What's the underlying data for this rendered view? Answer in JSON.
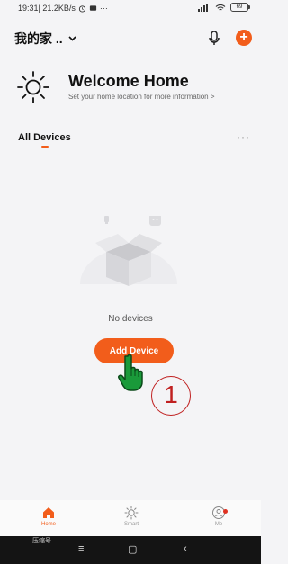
{
  "status_bar": {
    "time_speed": "19:31| 21.2KB/s",
    "more": "···",
    "signal": "░▐",
    "battery": "69"
  },
  "header": {
    "home_name": "我的家 ..",
    "chevron": "⌄"
  },
  "welcome": {
    "title": "Welcome Home",
    "subtitle": "Set your home location for more information >"
  },
  "devices": {
    "tab_label": "All Devices",
    "more": "···",
    "empty_text": "No devices",
    "add_button": "Add Device"
  },
  "annotation": {
    "step_number": "1"
  },
  "bottom_nav": {
    "items": [
      {
        "label": "Home",
        "icon": "home-icon",
        "active": true
      },
      {
        "label": "Smart",
        "icon": "sun-icon",
        "active": false
      },
      {
        "label": "Me",
        "icon": "profile-icon",
        "active": false
      }
    ]
  },
  "system_nav": {
    "label": "压缩号",
    "menu": "≡",
    "home": "▢",
    "back": "‹"
  },
  "colors": {
    "accent": "#f25d1b",
    "background": "#f4f4f6",
    "annotation": "#c02020",
    "hand": "#1a9a3a"
  }
}
